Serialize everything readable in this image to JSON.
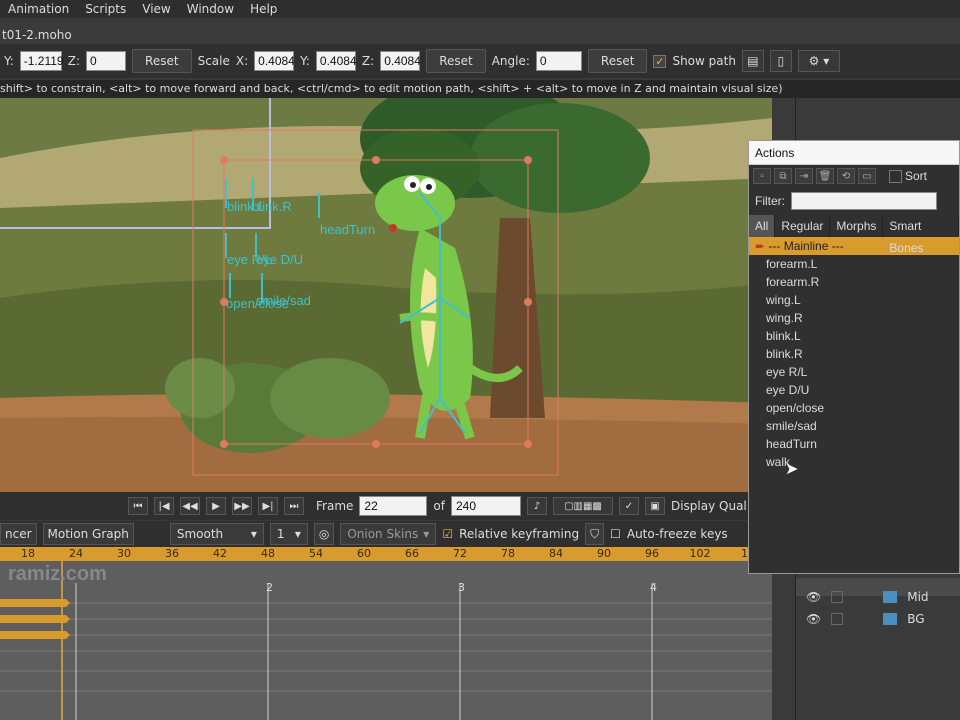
{
  "menu": [
    "Animation",
    "Scripts",
    "View",
    "Window",
    "Help"
  ],
  "document_tab": "t01-2.moho",
  "toolbar": {
    "y_label": "Y:",
    "y_value": "-1.2119",
    "z_label": "Z:",
    "z_value": "0",
    "reset1": "Reset",
    "scale_label": "Scale",
    "sx_label": "X:",
    "sx_value": "0.4084",
    "sy_label": "Y:",
    "sy_value": "0.4084",
    "sz_label": "Z:",
    "sz_value": "0.4084",
    "reset2": "Reset",
    "angle_label": "Angle:",
    "angle_value": "0",
    "reset3": "Reset",
    "show_path": "Show path"
  },
  "hint": "shift> to constrain, <alt> to move forward and back, <ctrl/cmd> to edit motion path, <shift> + <alt> to move in Z and maintain visual size)",
  "canvas_labels": [
    "blink.L",
    "blink.R",
    "headTurn",
    "eye R/L",
    "eye D/U",
    "open/close",
    "smile/sad"
  ],
  "playbar": {
    "frame_label": "Frame",
    "frame_value": "22",
    "of_label": "of",
    "total_value": "240",
    "display_quality": "Display Qual"
  },
  "timeline": {
    "tab_sequencer": "ncer",
    "tab_motion": "Motion Graph",
    "interp": "Smooth",
    "interp_num": "1",
    "onion": "Onion Skins",
    "relative": "Relative keyframing",
    "autofreeze": "Auto-freeze keys",
    "ruler_ticks": [
      "18",
      "24",
      "30",
      "36",
      "42",
      "48",
      "54",
      "60",
      "66",
      "72",
      "78",
      "84",
      "90",
      "96",
      "102",
      "10"
    ],
    "watermark": "ramiz.com",
    "sec_markers": [
      "2",
      "3",
      "4"
    ]
  },
  "layers": [
    "Mid",
    "BG"
  ],
  "actions": {
    "title": "Actions",
    "sort": "Sort",
    "filter_label": "Filter:",
    "tabs": [
      "All",
      "Regular",
      "Morphs",
      "Smart Bones"
    ],
    "items": [
      "--- Mainline ---",
      "forearm.L",
      "forearm.R",
      "wing.L",
      "wing.R",
      "blink.L",
      "blink.R",
      "eye R/L",
      "eye D/U",
      "open/close",
      "smile/sad",
      "headTurn",
      "walk"
    ]
  },
  "colors": {
    "accent": "#d89b2e",
    "bone": "#3fc1c9"
  }
}
